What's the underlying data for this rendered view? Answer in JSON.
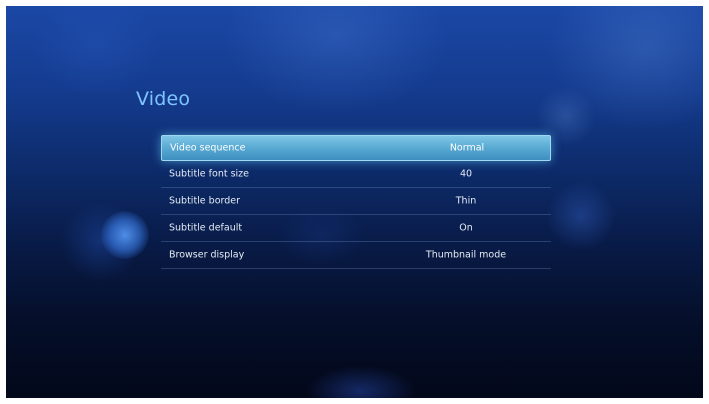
{
  "page": {
    "title": "Video"
  },
  "settings": [
    {
      "label": "Video sequence",
      "value": "Normal",
      "selected": true
    },
    {
      "label": "Subtitle font size",
      "value": "40",
      "selected": false
    },
    {
      "label": "Subtitle border",
      "value": "Thin",
      "selected": false
    },
    {
      "label": "Subtitle default",
      "value": "On",
      "selected": false
    },
    {
      "label": "Browser display",
      "value": "Thumbnail mode",
      "selected": false
    }
  ],
  "colors": {
    "title": "#7fc4ff",
    "highlight": "#58a9d3",
    "background_top": "#1b48a6",
    "background_bottom": "#03081a"
  }
}
